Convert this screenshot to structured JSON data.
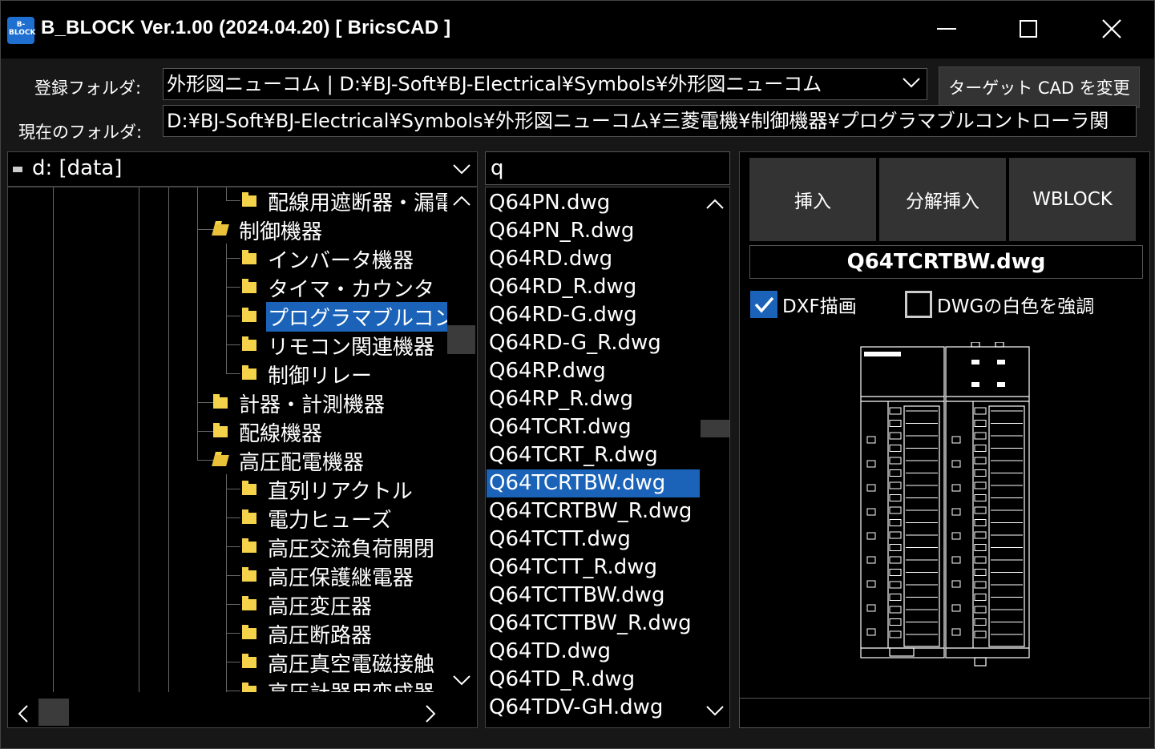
{
  "window": {
    "icon_text": "B-\nBLOCK",
    "title": "B_BLOCK Ver.1.00 (2024.04.20) [ BricsCAD ]"
  },
  "folder_row": {
    "registered_label": "登録フォルダ:",
    "registered_value": "外形図ニューコム | D:¥BJ-Soft¥BJ-Electrical¥Symbols¥外形図ニューコム",
    "current_label": "現在のフォルダ:",
    "current_value": "D:¥BJ-Soft¥BJ-Electrical¥Symbols¥外形図ニューコム¥三菱電機¥制御機器¥プログラマブルコントローラ関",
    "change_cad_button": "ターゲット CAD を変更"
  },
  "drive": {
    "label": "d: [data]"
  },
  "tree": {
    "nodes": [
      {
        "label": "配線用遮断器・漏電"
      },
      {
        "label": "制御機器"
      },
      {
        "label": "インバータ機器"
      },
      {
        "label": "タイマ・カウンタ"
      },
      {
        "label": "プログラマブルコントロ"
      },
      {
        "label": "リモコン関連機器"
      },
      {
        "label": "制御リレー"
      },
      {
        "label": "計器・計測機器"
      },
      {
        "label": "配線機器"
      },
      {
        "label": "高圧配電機器"
      },
      {
        "label": "直列リアクトル"
      },
      {
        "label": "電力ヒューズ"
      },
      {
        "label": "高圧交流負荷開閉"
      },
      {
        "label": "高圧保護継電器"
      },
      {
        "label": "高圧変圧器"
      },
      {
        "label": "高圧断路器"
      },
      {
        "label": "高圧真空電磁接触"
      },
      {
        "label": "高圧計器用変成器"
      }
    ]
  },
  "search": {
    "value": "q"
  },
  "files": {
    "items": [
      "Q64PN.dwg",
      "Q64PN_R.dwg",
      "Q64RD.dwg",
      "Q64RD_R.dwg",
      "Q64RD-G.dwg",
      "Q64RD-G_R.dwg",
      "Q64RP.dwg",
      "Q64RP_R.dwg",
      "Q64TCRT.dwg",
      "Q64TCRT_R.dwg",
      "Q64TCRTBW.dwg",
      "Q64TCRTBW_R.dwg",
      "Q64TCTT.dwg",
      "Q64TCTT_R.dwg",
      "Q64TCTTBW.dwg",
      "Q64TCTTBW_R.dwg",
      "Q64TD.dwg",
      "Q64TD_R.dwg",
      "Q64TDV-GH.dwg"
    ],
    "selected": "Q64TCRTBW.dwg"
  },
  "actions": {
    "insert": "挿入",
    "explode_insert": "分解挿入",
    "wblock": "WBLOCK"
  },
  "preview": {
    "file_name": "Q64TCRTBW.dwg",
    "dxf_render_label": "DXF描画",
    "dxf_render_checked": true,
    "dwg_white_label": "DWGの白色を強調",
    "dwg_white_checked": false
  },
  "colors": {
    "accent": "#1a63b8",
    "folder": "#f4d34a",
    "background": "#000000",
    "panel": "#171717",
    "button": "#333333"
  }
}
